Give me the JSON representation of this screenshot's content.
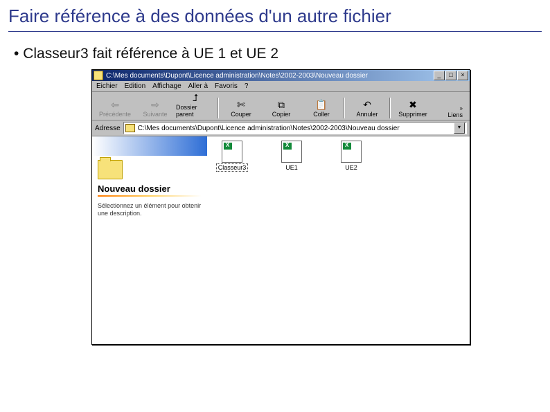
{
  "slide": {
    "title": "Faire référence à des données d'un autre fichier",
    "bullet": "Classeur3 fait référence à UE 1 et UE 2"
  },
  "window": {
    "title": "C:\\Mes documents\\Dupont\\Licence administration\\Notes\\2002-2003\\Nouveau dossier",
    "minimize_glyph": "_",
    "maximize_glyph": "□",
    "close_glyph": "×",
    "throbber_glyph": "e"
  },
  "menu": {
    "items": [
      "Eichier",
      "Edition",
      "Affichage",
      "Aller à",
      "Favoris",
      "?"
    ]
  },
  "toolbar": {
    "back": "Précédente",
    "forward": "Suivante",
    "up": "Dossier parent",
    "cut": "Couper",
    "copy": "Copier",
    "paste": "Coller",
    "undo": "Annuler",
    "delete": "Supprimer",
    "links_label": "Liens",
    "chev": "»",
    "icons": {
      "back": "⇦",
      "forward": "⇨",
      "up": "⮥",
      "cut": "✄",
      "copy": "⧉",
      "paste": "📋",
      "undo": "↶",
      "delete": "✖"
    }
  },
  "address": {
    "label": "Adresse",
    "path": "C:\\Mes documents\\Dupont\\Licence administration\\Notes\\2002-2003\\Nouveau dossier",
    "dropdown_glyph": "▾"
  },
  "sidepanel": {
    "heading": "Nouveau dossier",
    "hint": "Sélectionnez un élément pour obtenir une description."
  },
  "files": [
    {
      "name": "Classeur3",
      "selected": true
    },
    {
      "name": "UE1",
      "selected": false
    },
    {
      "name": "UE2",
      "selected": false
    }
  ]
}
